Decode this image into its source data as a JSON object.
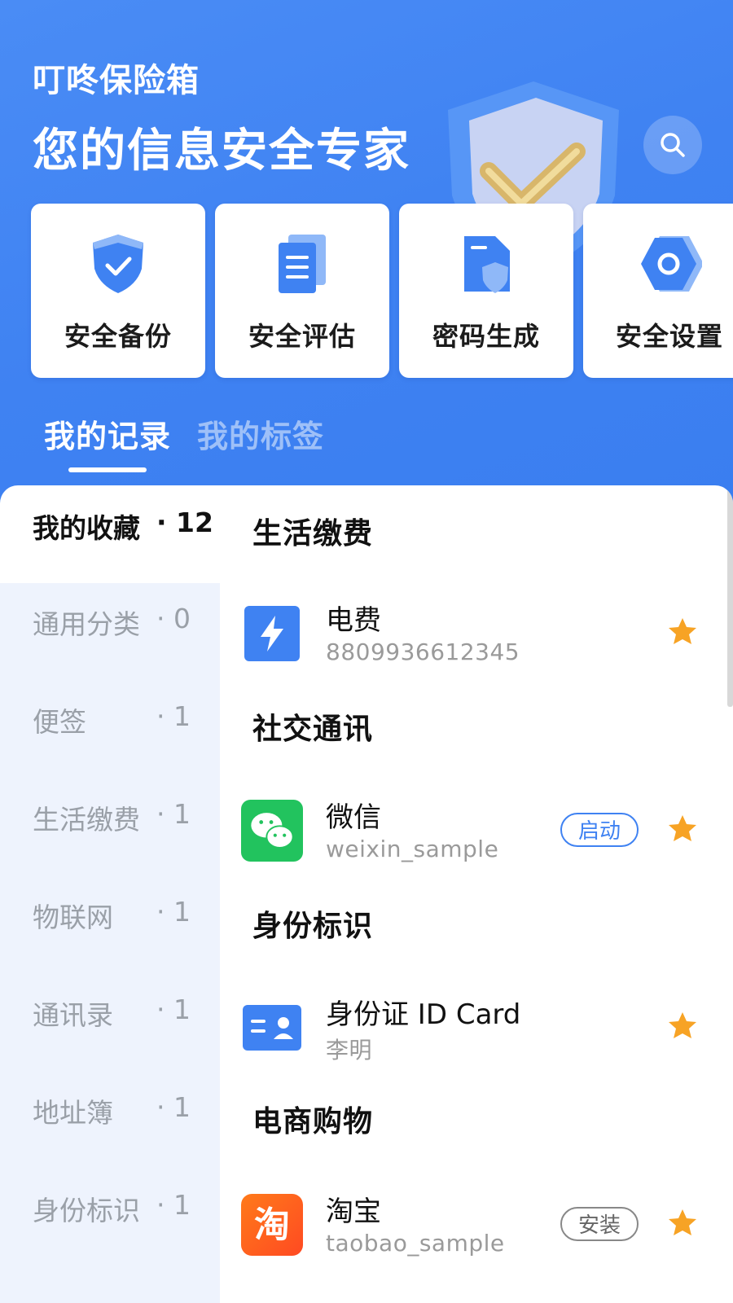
{
  "header": {
    "app_name": "叮咚保险箱",
    "slogan": "您的信息安全专家"
  },
  "shortcuts": [
    {
      "label": "安全备份",
      "icon": "shield-check-icon"
    },
    {
      "label": "安全评估",
      "icon": "document-list-icon"
    },
    {
      "label": "密码生成",
      "icon": "file-shield-icon"
    },
    {
      "label": "安全设置",
      "icon": "hexagon-gear-icon"
    }
  ],
  "tabs": [
    {
      "label": "我的记录",
      "active": true
    },
    {
      "label": "我的标签",
      "active": false
    }
  ],
  "sidebar": {
    "items": [
      {
        "name": "我的收藏",
        "count": "· 12",
        "active": true
      },
      {
        "name": "通用分类",
        "count": "· 0"
      },
      {
        "name": "便签",
        "count": "· 1"
      },
      {
        "name": "生活缴费",
        "count": "· 1"
      },
      {
        "name": "物联网",
        "count": "· 1"
      },
      {
        "name": "通讯录",
        "count": "· 1"
      },
      {
        "name": "地址簿",
        "count": "· 1"
      },
      {
        "name": "身份标识",
        "count": "· 1"
      }
    ]
  },
  "sections": [
    {
      "title": "生活缴费",
      "entry": {
        "title": "电费",
        "subtitle": "8809936612345",
        "icon": "lightning-icon",
        "action": null,
        "starred": true
      }
    },
    {
      "title": "社交通讯",
      "entry": {
        "title": "微信",
        "subtitle": "weixin_sample",
        "icon": "wechat-icon",
        "action": "启动",
        "starred": true
      }
    },
    {
      "title": "身份标识",
      "entry": {
        "title": "身份证 ID Card",
        "subtitle": "李明",
        "icon": "id-card-icon",
        "action": null,
        "starred": true
      }
    },
    {
      "title": "电商购物",
      "entry": {
        "title": "淘宝",
        "subtitle": "taobao_sample",
        "icon": "taobao-icon",
        "action": "安装",
        "starred": true
      }
    }
  ],
  "colors": {
    "accent": "#3f82f2",
    "header_bg": "#4a8cf5",
    "star": "#f7a325",
    "wechat": "#22c35e",
    "taobao": "#ff5a1f"
  }
}
